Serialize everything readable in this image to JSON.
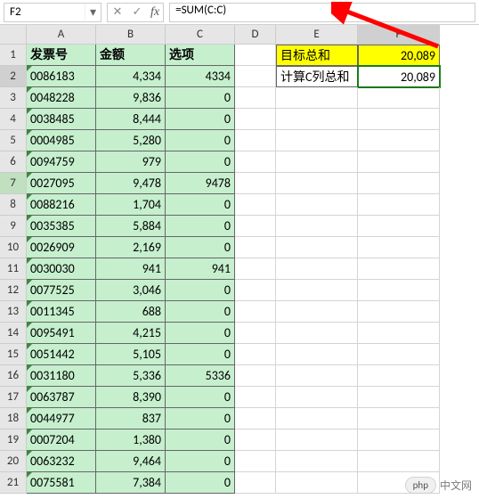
{
  "formula_bar": {
    "cell_ref": "F2",
    "cancel": "✕",
    "confirm": "✓",
    "fx": "fx",
    "formula": "=SUM(C:C)"
  },
  "columns": [
    "A",
    "B",
    "C",
    "D",
    "E",
    "F"
  ],
  "row_numbers": [
    1,
    2,
    3,
    4,
    5,
    6,
    7,
    8,
    9,
    10,
    11,
    12,
    13,
    14,
    15,
    16,
    17,
    18,
    19,
    20,
    21
  ],
  "headers": {
    "A": "发票号",
    "B": "金额",
    "C": "选项"
  },
  "side": {
    "r1": {
      "E": "目标总和",
      "F": "20,089"
    },
    "r2": {
      "E": "计算C列总和",
      "F": "20,089"
    }
  },
  "rows": [
    {
      "a": "0086183",
      "b": "4,334",
      "c": "4334"
    },
    {
      "a": "0048228",
      "b": "9,836",
      "c": "0"
    },
    {
      "a": "0038485",
      "b": "8,444",
      "c": "0"
    },
    {
      "a": "0004985",
      "b": "5,280",
      "c": "0"
    },
    {
      "a": "0094759",
      "b": "979",
      "c": "0"
    },
    {
      "a": "0027095",
      "b": "9,478",
      "c": "9478"
    },
    {
      "a": "0088216",
      "b": "1,704",
      "c": "0"
    },
    {
      "a": "0035385",
      "b": "5,884",
      "c": "0"
    },
    {
      "a": "0026909",
      "b": "2,169",
      "c": "0"
    },
    {
      "a": "0030030",
      "b": "941",
      "c": "941"
    },
    {
      "a": "0077525",
      "b": "3,046",
      "c": "0"
    },
    {
      "a": "0011345",
      "b": "688",
      "c": "0"
    },
    {
      "a": "0095491",
      "b": "4,215",
      "c": "0"
    },
    {
      "a": "0051442",
      "b": "5,105",
      "c": "0"
    },
    {
      "a": "0031180",
      "b": "5,336",
      "c": "5336"
    },
    {
      "a": "0063787",
      "b": "8,390",
      "c": "0"
    },
    {
      "a": "0044977",
      "b": "837",
      "c": "0"
    },
    {
      "a": "0007204",
      "b": "1,380",
      "c": "0"
    },
    {
      "a": "0063232",
      "b": "9,464",
      "c": "0"
    },
    {
      "a": "0075581",
      "b": "7,384",
      "c": "0"
    }
  ],
  "watermark": {
    "badge": "php",
    "text": "中文网"
  },
  "chart_data": {
    "type": "table",
    "title": "",
    "columns": [
      "发票号",
      "金额",
      "选项"
    ],
    "rows": [
      [
        "0086183",
        4334,
        4334
      ],
      [
        "0048228",
        9836,
        0
      ],
      [
        "0038485",
        8444,
        0
      ],
      [
        "0004985",
        5280,
        0
      ],
      [
        "0094759",
        979,
        0
      ],
      [
        "0027095",
        9478,
        9478
      ],
      [
        "0088216",
        1704,
        0
      ],
      [
        "0035385",
        5884,
        0
      ],
      [
        "0026909",
        2169,
        0
      ],
      [
        "0030030",
        941,
        941
      ],
      [
        "0077525",
        3046,
        0
      ],
      [
        "0011345",
        688,
        0
      ],
      [
        "0095491",
        4215,
        0
      ],
      [
        "0051442",
        5105,
        0
      ],
      [
        "0031180",
        5336,
        5336
      ],
      [
        "0063787",
        8390,
        0
      ],
      [
        "0044977",
        837,
        0
      ],
      [
        "0007204",
        1380,
        0
      ],
      [
        "0063232",
        9464,
        0
      ],
      [
        "0075581",
        7384,
        0
      ]
    ],
    "summary": {
      "目标总和": 20089,
      "计算C列总和": 20089
    },
    "formula": "=SUM(C:C)"
  }
}
